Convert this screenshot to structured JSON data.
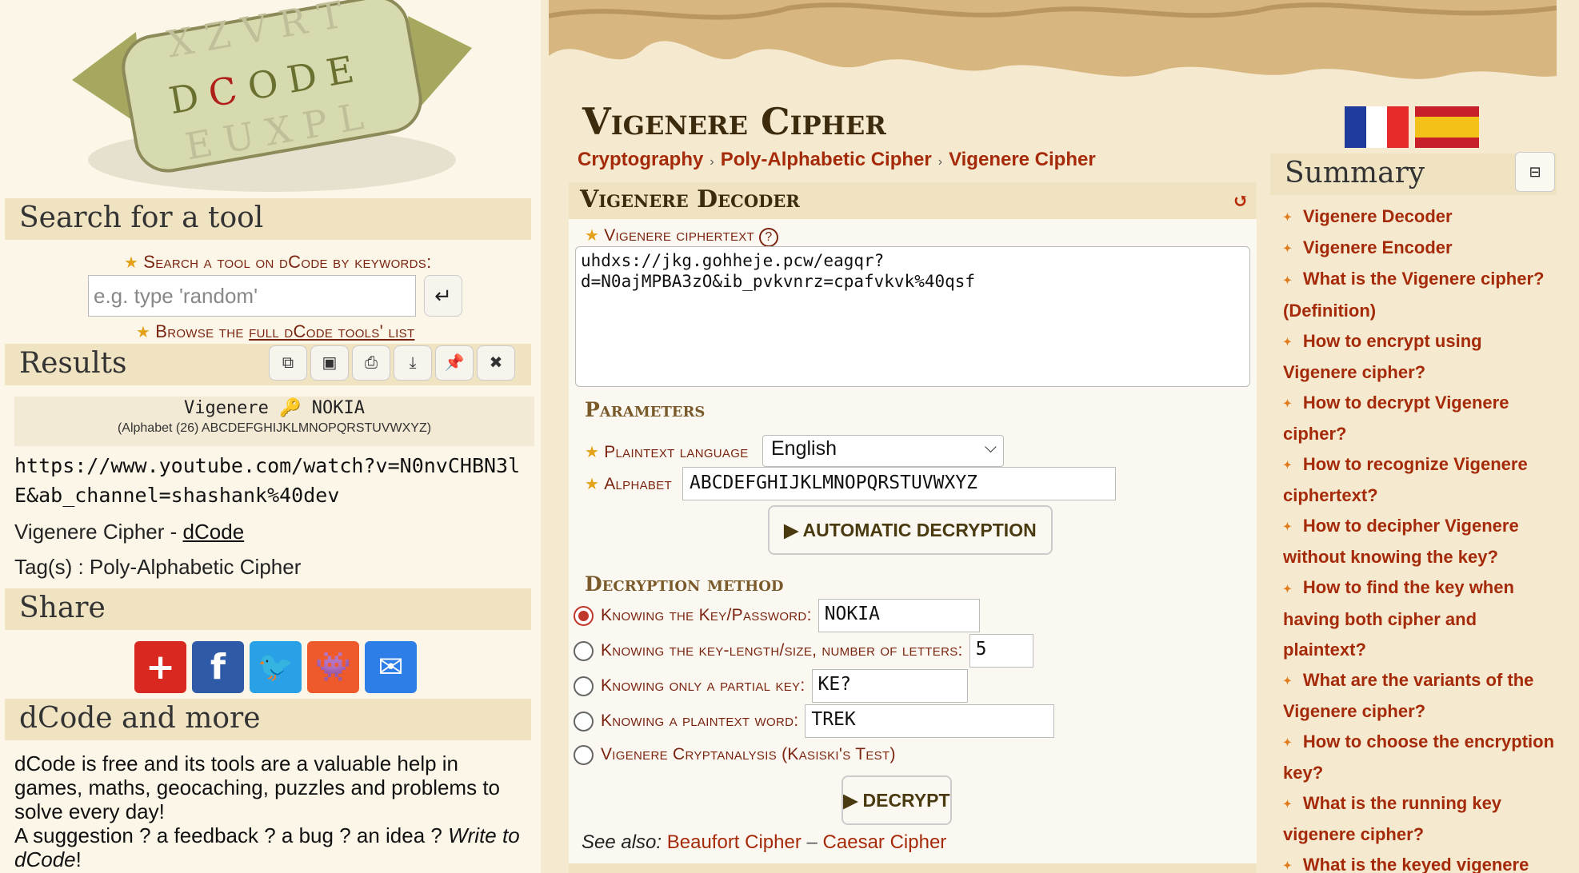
{
  "search": {
    "title": "Search for a tool",
    "label": "Search a tool on dCode by keywords:",
    "placeholder": "e.g. type 'random'",
    "browse_prefix": "Browse the ",
    "browse_link": "full dCode tools' list"
  },
  "results": {
    "title": "Results",
    "line1": "Vigenere 🔑 NOKIA",
    "line2": "(Alphabet (26) ABCDEFGHIJKLMNOPQRSTUVWXYZ)",
    "output": "https://www.youtube.com/watch?v=N0nvCHBN3lE&ab_channel=shashank%40dev",
    "source_prefix": "Vigenere Cipher - ",
    "source_link": "dCode",
    "tags": "Tag(s) : Poly-Alphabetic Cipher"
  },
  "share": {
    "title": "Share"
  },
  "more": {
    "title": "dCode and more",
    "text1": "dCode is free and its tools are a valuable help in games, maths, geocaching, puzzles and problems to solve every day!",
    "text2a": "A suggestion ? a feedback ? a bug ? an idea ? ",
    "text2b": "Write to dCode",
    "text2c": "!"
  },
  "page": {
    "title": "Vigenere Cipher",
    "breadcrumb": [
      "Cryptography",
      "Poly-Alphabetic Cipher",
      "Vigenere Cipher"
    ]
  },
  "decoder": {
    "title": "Vigenere Decoder",
    "cipher_label": "Vigenere ciphertext",
    "cipher_value": "uhdxs://jkg.gohheje.pcw/eagqr?\nd=N0ajMPBA3zO&ib_pvkvnrz=cpafvkvk%40qsf",
    "params_title": "Parameters",
    "lang_label": "Plaintext language",
    "lang_value": "English",
    "alpha_label": "Alphabet",
    "alpha_value": "ABCDEFGHIJKLMNOPQRSTUVWXYZ",
    "auto_btn": "AUTOMATIC DECRYPTION",
    "method_title": "Decryption method",
    "methods": [
      {
        "label": "Knowing the Key/Password:",
        "value": "NOKIA",
        "selected": true
      },
      {
        "label": "Knowing the key-length/size, number of letters:",
        "value": "5",
        "selected": false
      },
      {
        "label": "Knowing only a partial key:",
        "value": "KE?",
        "selected": false
      },
      {
        "label": "Knowing a plaintext word:",
        "value": "TREK",
        "selected": false
      },
      {
        "label": "Vigenere Cryptanalysis (Kasiski's Test)",
        "value": null,
        "selected": false
      }
    ],
    "decrypt_btn": "DECRYPT",
    "see_also_label": "See also:",
    "see_also": [
      "Beaufort Cipher",
      "Caesar Cipher"
    ],
    "see_also_sep": "–"
  },
  "summary": {
    "title": "Summary",
    "items": [
      "Vigenere Decoder",
      "Vigenere Encoder",
      "What is the Vigenere cipher? (Definition)",
      "How to encrypt using Vigenere cipher?",
      "How to decrypt Vigenere cipher?",
      "How to recognize Vigenere ciphertext?",
      "How to decipher Vigenere without knowing the key?",
      "How to find the key when having both cipher and plaintext?",
      "What are the variants of the Vigenere cipher?",
      "How to choose the encryption key?",
      "What is the running key vigenere cipher?",
      "What is the keyed vigenere"
    ]
  },
  "logo": {
    "letters_top": [
      "X",
      "Z",
      "V",
      "R",
      "T"
    ],
    "letters_mid": [
      "D",
      "C",
      "O",
      "D",
      "E"
    ],
    "letters_bottom": [
      "E",
      "U",
      "X",
      "P",
      "L"
    ]
  },
  "colors": {
    "accent": "#a52a0a",
    "header_bg": "#efe3c2",
    "page_bg": "#f5ead0"
  }
}
